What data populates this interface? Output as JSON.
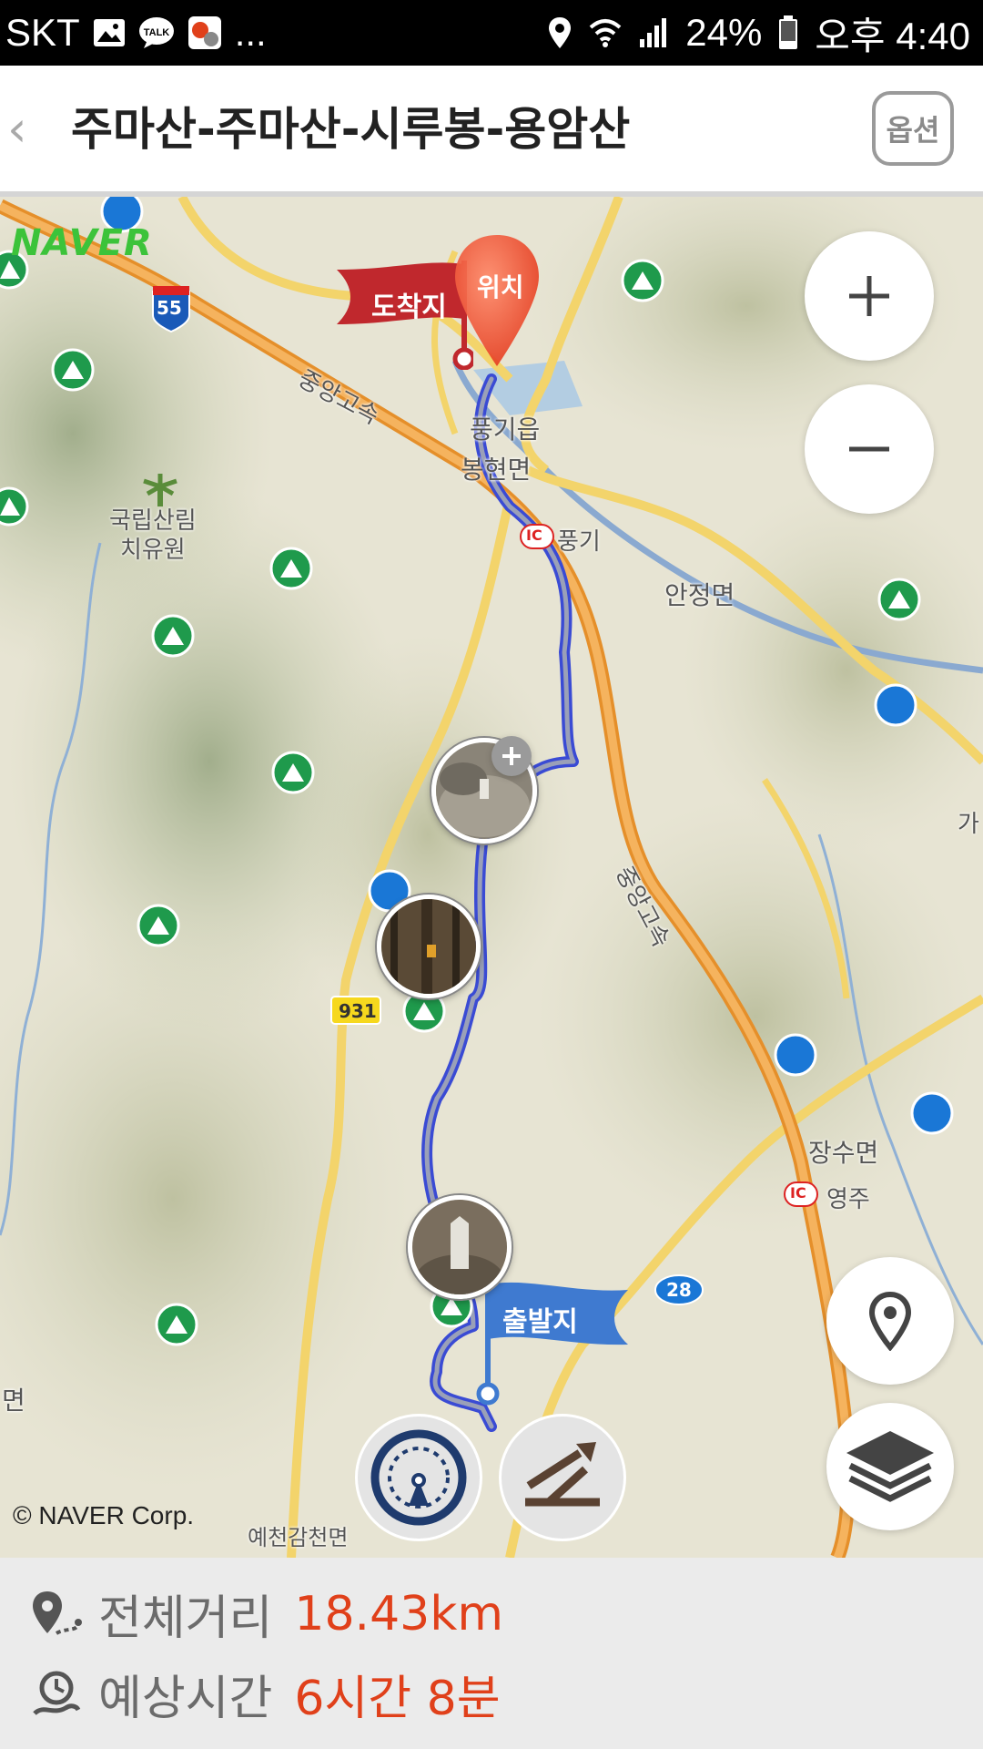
{
  "statusbar": {
    "carrier": "SKT",
    "more": "...",
    "battery": "24%",
    "time": "오후 4:40",
    "icons": [
      "gallery-icon",
      "talk-icon",
      "hiking-app-icon",
      "location-icon",
      "wifi-icon",
      "signal-icon",
      "battery-icon"
    ]
  },
  "header": {
    "back_glyph": "‹",
    "title": "주마산-주마산-시루봉-용암산",
    "option_label": "옵션"
  },
  "map": {
    "provider_logo": "NAVER",
    "copyright": "© NAVER Corp.",
    "labels": {
      "forest": "국립산림\n치유원",
      "highway_top": "중앙고속",
      "highway_mid": "중앙고속",
      "town1": "풍기읍",
      "town2": "봉현면",
      "ic_punggi": "풍기",
      "anjeong": "안정면",
      "jangsu": "장수면",
      "ic_yeongju": "영주",
      "yecheon": "예천감천면",
      "myeon_left": "면",
      "ga": "가",
      "route_931": "931",
      "route_28": "28",
      "route_55": "55",
      "ic": "IC"
    },
    "arrival_flag": "도착지",
    "location_pin": "위치",
    "departure_flag": "출발지"
  },
  "summary": {
    "distance_label": "전체거리",
    "distance_value": "18.43km",
    "time_label": "예상시간",
    "time_value": "6시간 8분"
  },
  "colors": {
    "route": "#3a4bd4",
    "highway": "#f0a74a",
    "road": "#f3d46b",
    "accent": "#e0401a",
    "arrival_flag": "#c0282d",
    "departure_flag": "#3f7ad0",
    "mountain_marker": "#1f9a4c"
  }
}
